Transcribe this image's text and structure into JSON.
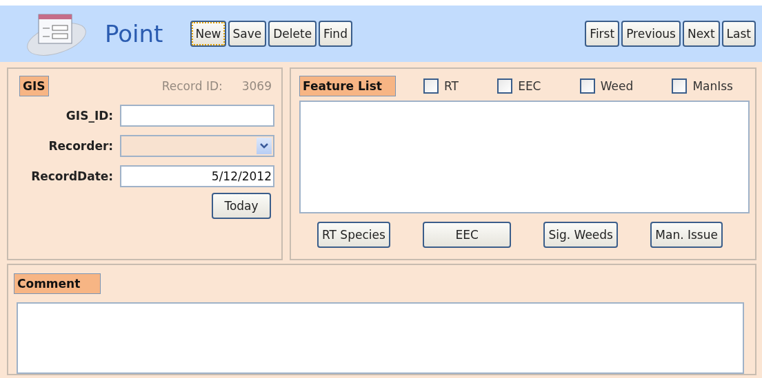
{
  "header": {
    "title": "Point",
    "actions": [
      {
        "label": "New",
        "focused": true
      },
      {
        "label": "Save",
        "focused": false
      },
      {
        "label": "Delete",
        "focused": false
      },
      {
        "label": "Find",
        "focused": false
      }
    ],
    "navigation": [
      {
        "label": "First"
      },
      {
        "label": "Previous"
      },
      {
        "label": "Next"
      },
      {
        "label": "Last"
      }
    ]
  },
  "gis": {
    "heading": "GIS",
    "record_id_label": "Record ID:",
    "record_id": "3069",
    "record_id_disabled": true,
    "fields": [
      {
        "kind": "text",
        "label": "GIS_ID:"
      },
      {
        "kind": "dropdown",
        "label": "Recorder:"
      },
      {
        "kind": "date",
        "label": "RecordDate:",
        "value": "5/12/2012"
      }
    ],
    "today_button": "Today"
  },
  "features": {
    "heading": "Feature List",
    "checks": [
      {
        "label": "RT",
        "checked": false
      },
      {
        "label": "EEC",
        "checked": false
      },
      {
        "label": "Weed",
        "checked": false
      },
      {
        "label": "ManIss",
        "checked": false
      }
    ],
    "buttons": [
      {
        "label": "RT Species"
      },
      {
        "label": "EEC"
      },
      {
        "label": "Sig. Weeds"
      },
      {
        "label": "Man. Issue"
      }
    ]
  },
  "comment": {
    "heading": "Comment"
  }
}
